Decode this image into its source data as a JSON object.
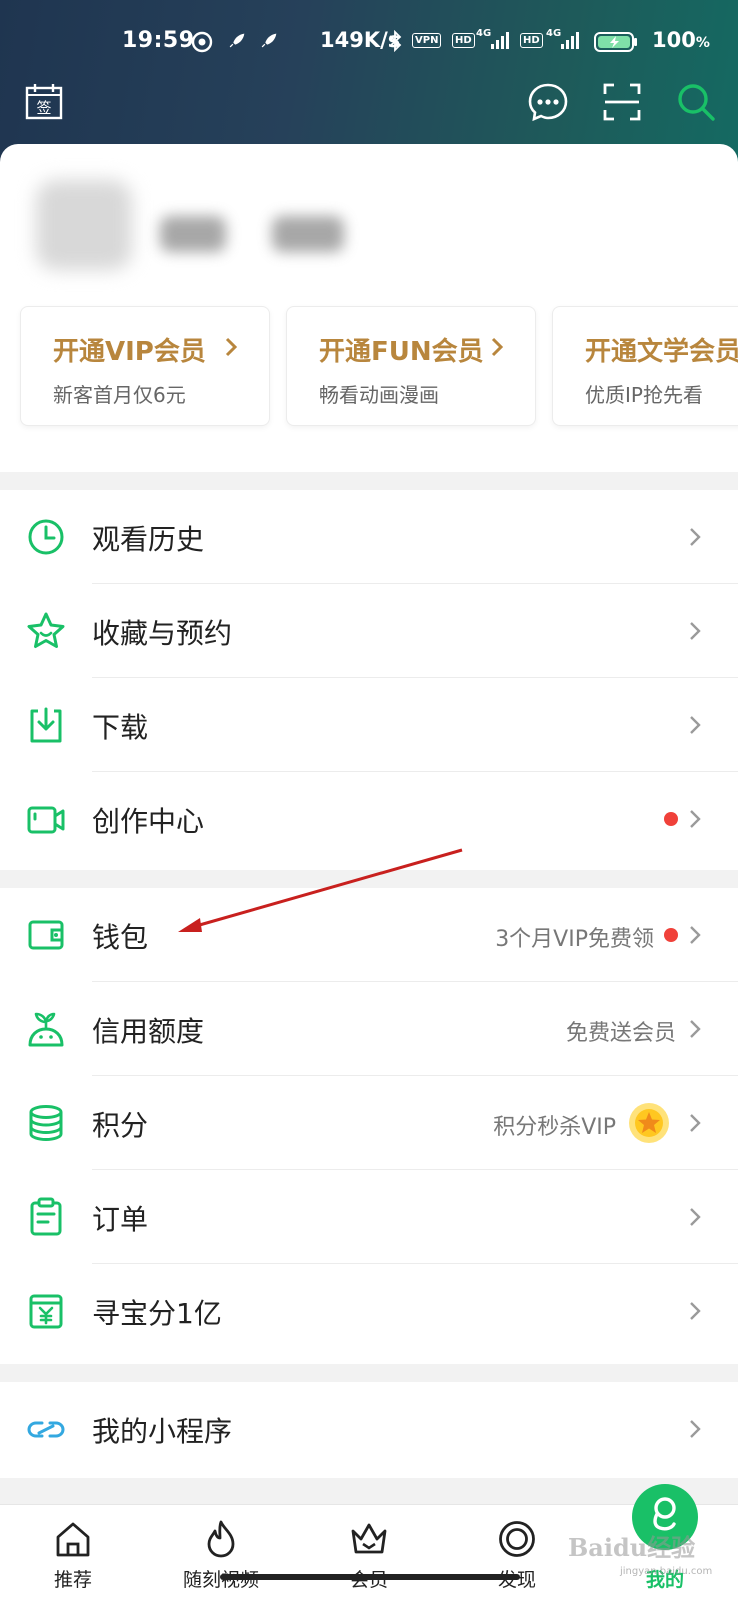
{
  "status_bar": {
    "time": "19:59",
    "speed": "149K/s",
    "vpn": "VPN",
    "hd1": "HD",
    "hd2": "HD",
    "net1": "4G",
    "net2": "4G",
    "battery": "100"
  },
  "header": {
    "sign_in_label": "签",
    "icons": [
      "calendar-sign-icon",
      "message-icon",
      "scan-icon",
      "search-icon"
    ]
  },
  "vip_cards": [
    {
      "title": "开通VIP会员",
      "subtitle": "新客首月仅6元"
    },
    {
      "title": "开通FUN会员",
      "subtitle": "畅看动画漫画"
    },
    {
      "title": "开通文学会员",
      "subtitle": "优质IP抢先看"
    }
  ],
  "menu_groups": [
    [
      {
        "label": "观看历史",
        "icon": "clock-icon"
      },
      {
        "label": "收藏与预约",
        "icon": "star-icon"
      },
      {
        "label": "下载",
        "icon": "download-icon"
      },
      {
        "label": "创作中心",
        "icon": "video-camera-icon",
        "dot": true
      }
    ],
    [
      {
        "label": "钱包",
        "icon": "wallet-icon",
        "hint": "3个月VIP免费领",
        "dot": true
      },
      {
        "label": "信用额度",
        "icon": "sprout-icon",
        "hint": "免费送会员"
      },
      {
        "label": "积分",
        "icon": "coins-icon",
        "hint": "积分秒杀VIP"
      },
      {
        "label": "订单",
        "icon": "clipboard-icon"
      },
      {
        "label": "寻宝分1亿",
        "icon": "treasure-icon"
      }
    ],
    [
      {
        "label": "我的小程序",
        "icon": "mini-program-icon"
      }
    ]
  ],
  "bottom_nav": [
    {
      "label": "推荐",
      "icon": "home-icon"
    },
    {
      "label": "随刻视频",
      "icon": "flame-icon"
    },
    {
      "label": "会员",
      "icon": "crown-icon"
    },
    {
      "label": "发现",
      "icon": "discover-icon"
    },
    {
      "label": "我的",
      "icon": "profile-icon",
      "active": true
    }
  ],
  "watermark": {
    "text": "Baidu经验",
    "sub": "jingyan.baidu.com"
  },
  "colors": {
    "accent_green": "#19c067",
    "vip_gold": "#b8863d",
    "dot_red": "#f0413a",
    "annotation_red": "#c8201e"
  }
}
